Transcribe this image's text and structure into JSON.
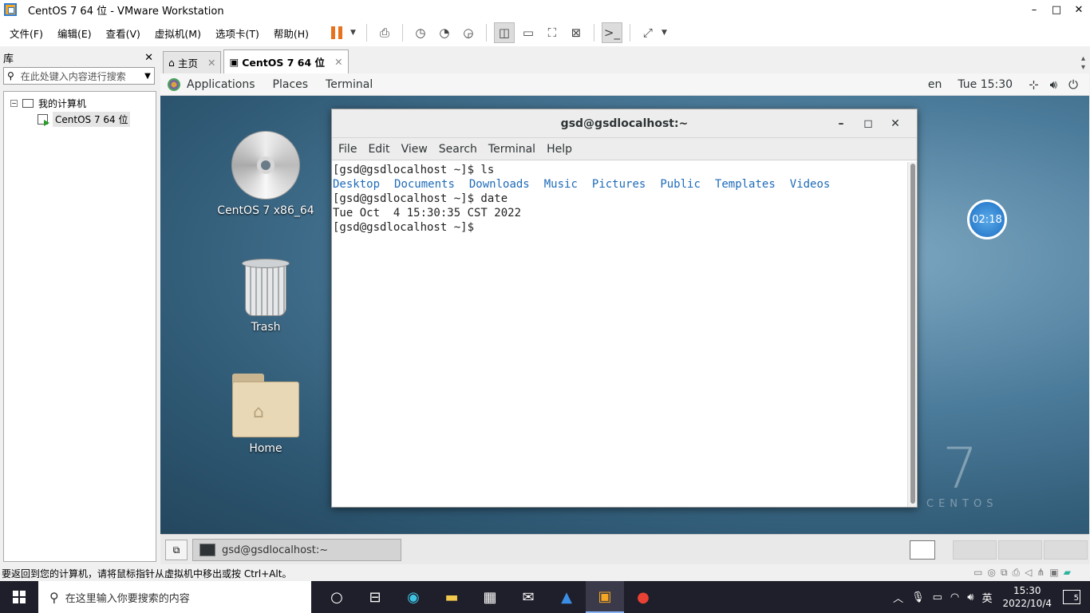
{
  "window": {
    "title": "CentOS 7 64 位 - VMware Workstation",
    "minimize": "–",
    "maximize": "□",
    "close": "✕"
  },
  "menu": {
    "file": "文件(F)",
    "edit": "编辑(E)",
    "view": "查看(V)",
    "vm": "虚拟机(M)",
    "tabs": "选项卡(T)",
    "help": "帮助(H)"
  },
  "library": {
    "title": "库",
    "close": "✕",
    "search_placeholder": "在此处键入内容进行搜索",
    "tree": {
      "my_computer": "我的计算机",
      "vm": "CentOS 7 64 位"
    }
  },
  "tabs": [
    {
      "label": "主页",
      "close": "✕"
    },
    {
      "label": "CentOS 7 64 位",
      "close": "✕"
    }
  ],
  "gnome": {
    "applications": "Applications",
    "places": "Places",
    "terminal": "Terminal",
    "lang": "en",
    "time": "Tue 15:30"
  },
  "desktop": {
    "disc_label": "CentOS 7 x86_64",
    "trash_label": "Trash",
    "home_label": "Home",
    "clock_widget": "02:18",
    "brand_number": "7",
    "brand_word": "CENTOS"
  },
  "terminal": {
    "title": "gsd@gsdlocalhost:~",
    "min": "–",
    "max": "◻",
    "close": "✕",
    "menu": {
      "file": "File",
      "edit": "Edit",
      "view": "View",
      "search": "Search",
      "terminal": "Terminal",
      "help": "Help"
    },
    "line1": "[gsd@gsdlocalhost ~]$ ls",
    "ls": [
      "Desktop",
      "Documents",
      "Downloads",
      "Music",
      "Pictures",
      "Public",
      "Templates",
      "Videos"
    ],
    "line3": "[gsd@gsdlocalhost ~]$ date",
    "line4": "Tue Oct  4 15:30:35 CST 2022",
    "line5": "[gsd@gsdlocalhost ~]$ "
  },
  "vm_taskbar": {
    "task_label": "gsd@gsdlocalhost:~"
  },
  "statusbar": {
    "message": "要返回到您的计算机，请将鼠标指针从虚拟机中移出或按 Ctrl+Alt。"
  },
  "win_taskbar": {
    "search_placeholder": "在这里输入你要搜索的内容",
    "ime": "英",
    "time": "15:30",
    "date": "2022/10/4",
    "notifications": "5"
  }
}
